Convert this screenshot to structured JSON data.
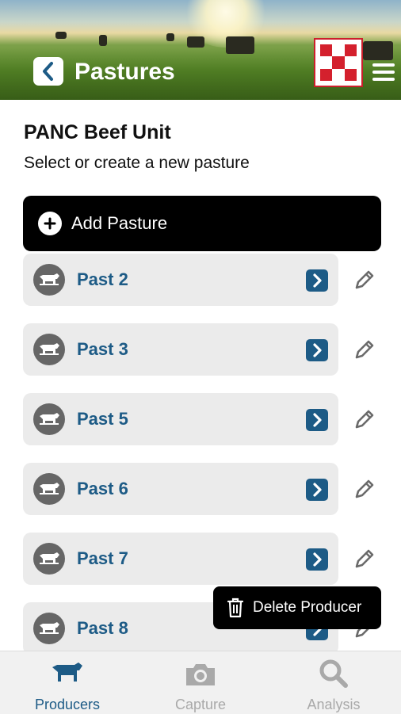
{
  "header": {
    "title": "Pastures",
    "back_icon": "chevron-left-icon",
    "menu_icon": "hamburger-menu-icon",
    "logo": "checkerboard-logo",
    "colors": {
      "logo_red": "#d4202d",
      "title": "#ffffff"
    }
  },
  "producer": {
    "name": "PANC Beef Unit",
    "subtitle": "Select or create a new pasture"
  },
  "add_button": {
    "label": "Add Pasture",
    "icon": "plus-circle-icon"
  },
  "pastures": [
    {
      "name": "Past 2"
    },
    {
      "name": "Past 3"
    },
    {
      "name": "Past 5"
    },
    {
      "name": "Past 6"
    },
    {
      "name": "Past 7"
    },
    {
      "name": "Past 8"
    }
  ],
  "row_icons": {
    "avatar": "cow-icon",
    "open": "chevron-right-icon",
    "edit": "pencil-icon"
  },
  "delete_button": {
    "label": "Delete Producer",
    "icon": "trash-icon"
  },
  "bottom_nav": {
    "items": [
      {
        "label": "Producers",
        "icon": "cow-icon",
        "active": true
      },
      {
        "label": "Capture",
        "icon": "camera-icon",
        "active": false
      },
      {
        "label": "Analysis",
        "icon": "magnifier-icon",
        "active": false
      }
    ],
    "colors": {
      "active": "#1d5b86",
      "inactive": "#a9a9a9"
    }
  }
}
